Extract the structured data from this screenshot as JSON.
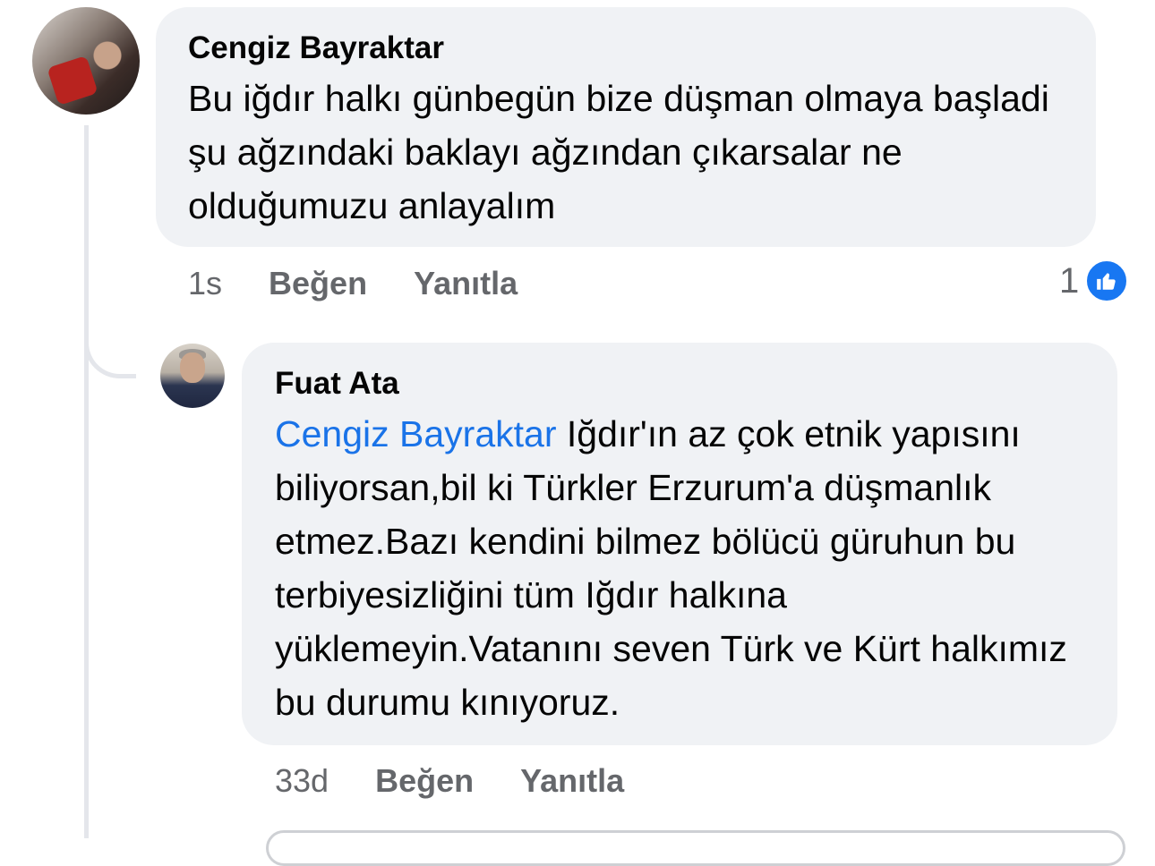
{
  "comments": [
    {
      "author": "Cengiz Bayraktar",
      "text": "Bu iğdır halkı günbegün bize düşman olmaya başladi şu ağzındaki baklayı ağzından çıkarsalar ne olduğumuzu anlayalım",
      "time": "1s",
      "like_label": "Beğen",
      "reply_label": "Yanıtla",
      "reaction_count": "1",
      "reaction_icon": "thumbs-up-icon"
    },
    {
      "author": "Fuat Ata",
      "mention": "Cengiz Bayraktar",
      "text": "Iğdır'ın az çok etnik yapısını biliyorsan,bil ki Türkler Erzurum'a düşmanlık etmez.Bazı kendini bilmez bölücü güruhun bu terbiyesizliğini tüm Iğdır halkına yüklemeyin.Vatanını seven Türk ve Kürt halkımız bu durumu kınıyoruz.",
      "time": "33d",
      "like_label": "Beğen",
      "reply_label": "Yanıtla"
    }
  ],
  "colors": {
    "bubble": "#f0f2f5",
    "mention": "#1a73e8",
    "meta": "#65676b",
    "like_badge": "#1877f2"
  }
}
